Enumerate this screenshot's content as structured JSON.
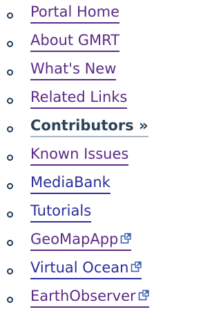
{
  "nav": {
    "items": [
      {
        "label": "Portal Home",
        "state": "visited"
      },
      {
        "label": "About GMRT",
        "state": "visited"
      },
      {
        "label": "What's New",
        "state": "visited"
      },
      {
        "label": "Related Links",
        "state": "visited"
      },
      {
        "label": "Contributors »",
        "state": "current"
      },
      {
        "label": "Known Issues",
        "state": "visited"
      },
      {
        "label": "MediaBank",
        "state": "link"
      },
      {
        "label": "Tutorials",
        "state": "link"
      },
      {
        "label": "GeoMapApp",
        "state": "visited",
        "icon": "external-link-icon"
      },
      {
        "label": "Virtual Ocean",
        "state": "link",
        "icon": "external-link-icon"
      },
      {
        "label": "EarthObserver",
        "state": "visited",
        "icon": "external-link-icon"
      }
    ]
  },
  "colors": {
    "link": "#2a2d9c",
    "visited": "#5c2a86",
    "current": "#2c4357",
    "bullet": "#1f3a5a"
  }
}
